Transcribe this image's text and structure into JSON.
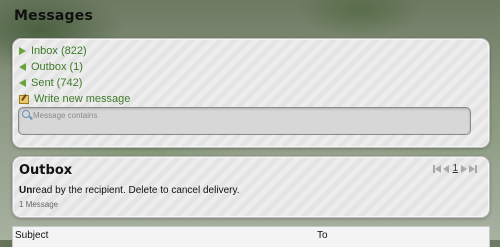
{
  "page": {
    "title": "Messages"
  },
  "folders": [
    {
      "id": "inbox",
      "label": "Inbox (822)",
      "icon": "arrow-right-icon"
    },
    {
      "id": "outbox",
      "label": "Outbox (1)",
      "icon": "arrow-left-icon"
    },
    {
      "id": "sent",
      "label": "Sent (742)",
      "icon": "arrow-left-icon"
    },
    {
      "id": "write",
      "label": "Write new message",
      "icon": "compose-icon"
    }
  ],
  "search": {
    "placeholder": "Message contains",
    "value": ""
  },
  "outbox": {
    "title": "Outbox",
    "desc_bold": "Un",
    "desc_rest": "read by the recipient. Delete to cancel delivery.",
    "count": "1 Message",
    "pager": {
      "current_page": "1"
    }
  },
  "table": {
    "columns": [
      "Subject",
      "To"
    ]
  },
  "colors": {
    "link_green": "#3e7a2a",
    "arrow_green": "#66a53c"
  }
}
